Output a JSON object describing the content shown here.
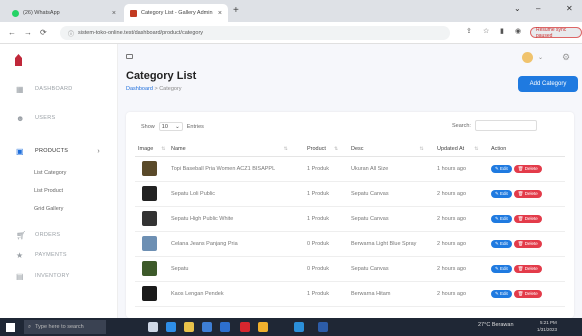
{
  "browser": {
    "tabs": [
      {
        "title": "(26) WhatsApp",
        "active": false
      },
      {
        "title": "Category List - Gallery Admin",
        "active": true
      }
    ],
    "url": "sistem-toko-online.test/dashboard/product/category",
    "profile_label": "Resume sync paused"
  },
  "sidebar": {
    "items": [
      {
        "label": "DASHBOARD",
        "icon": "grid-icon"
      },
      {
        "label": "USERS",
        "icon": "users-icon"
      },
      {
        "label": "PRODUCTS",
        "icon": "products-icon",
        "active": true
      },
      {
        "label": "ORDERS",
        "icon": "cart-icon"
      },
      {
        "label": "PAYMENTS",
        "icon": "star-icon"
      },
      {
        "label": "INVENTORY",
        "icon": "inventory-icon"
      }
    ],
    "sub_items": [
      "List Category",
      "List Product",
      "Grid Gallery"
    ]
  },
  "header": {
    "title": "Category List",
    "breadcrumb_root": "Dashboard",
    "breadcrumb_sep": ">",
    "breadcrumb_current": "Category",
    "add_button": "Add Category"
  },
  "table": {
    "show_label": "Show",
    "entries_value": "10",
    "entries_suffix": "Entries",
    "search_label": "Search:",
    "columns": [
      "Image",
      "Name",
      "Product",
      "Desc",
      "Updated At",
      "Action"
    ],
    "rows": [
      {
        "name": "Topi Baseball Pria Women ACZ1 BISAPPL",
        "product": "1 Produk",
        "desc": "Ukuran All Size",
        "updated": "1 hours ago",
        "thumb_color": "#5a4a2a"
      },
      {
        "name": "Sepatu Loli Public",
        "product": "1 Produk",
        "desc": "Sepatu Canvas",
        "updated": "2 hours ago",
        "thumb_color": "#222222"
      },
      {
        "name": "Sepatu High Public White",
        "product": "1 Produk",
        "desc": "Sepatu Canvas",
        "updated": "2 hours ago",
        "thumb_color": "#333333"
      },
      {
        "name": "Celana Jeans Panjang Pria",
        "product": "0 Produk",
        "desc": "Berwarna Light Blue Spray",
        "updated": "2 hours ago",
        "thumb_color": "#6d8fb3"
      },
      {
        "name": "Sepatu",
        "product": "0 Produk",
        "desc": "Sepatu Canvas",
        "updated": "2 hours ago",
        "thumb_color": "#3d5a2a"
      },
      {
        "name": "Kaos Lengan Pendek",
        "product": "1 Produk",
        "desc": "Berwarna Hitam",
        "updated": "2 hours ago",
        "thumb_color": "#1a1a1a"
      }
    ],
    "edit_label": "Edit",
    "delete_label": "Delete"
  },
  "taskbar": {
    "search_placeholder": "Type here to search",
    "weather": "27°C Berawan",
    "time": "5:21 PM",
    "date": "1/31/2023"
  },
  "colors": {
    "primary": "#1f7ae0",
    "danger": "#e33b4a",
    "sidebar_active": "#1f6fdc"
  }
}
